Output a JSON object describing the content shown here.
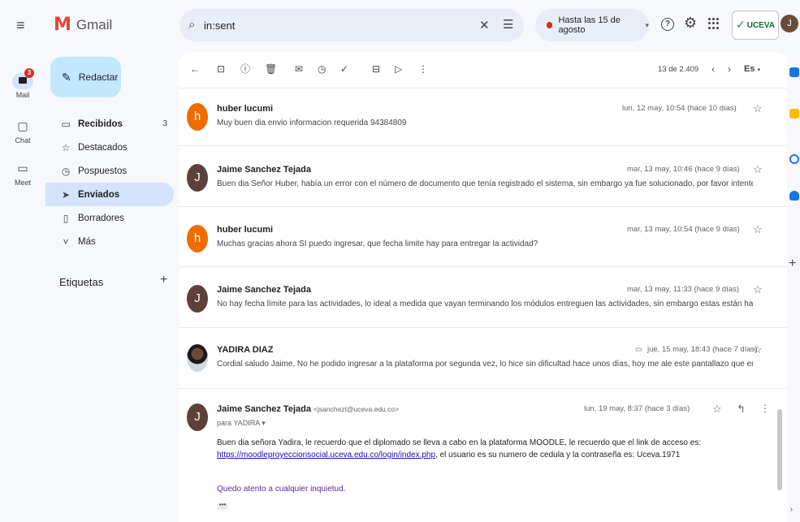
{
  "app": {
    "name": "Gmail"
  },
  "search": {
    "query": "in:sent"
  },
  "status": {
    "label": "Hasta las 15 de agosto"
  },
  "account": {
    "brand": "UCEVA",
    "avatar_letter": "J"
  },
  "rail": {
    "items": [
      {
        "label": "Mail",
        "badge": "3"
      },
      {
        "label": "Chat"
      },
      {
        "label": "Meet"
      }
    ]
  },
  "compose": {
    "label": "Redactar"
  },
  "nav": {
    "items": [
      {
        "label": "Recibidos",
        "count": "3"
      },
      {
        "label": "Destacados"
      },
      {
        "label": "Pospuestos"
      },
      {
        "label": "Enviados"
      },
      {
        "label": "Borradores"
      },
      {
        "label": "Más"
      }
    ]
  },
  "labels": {
    "title": "Etiquetas"
  },
  "toolbar": {
    "pager": "13 de 2.409",
    "lang": "Es"
  },
  "thread": [
    {
      "avatar_letter": "h",
      "sender": "huber lucumi",
      "date": "lun, 12 may, 10:54 (hace 10 días)",
      "snippet": "Muy buen dia envio informacion requerida 94384809"
    },
    {
      "avatar_letter": "J",
      "sender": "Jaime Sanchez Tejada",
      "date": "mar, 13 may, 10:46 (hace 9 días)",
      "snippet": "Buen dia Señor Huber, había un error con el número de documento que tenía registrado el sistema, sin embargo ya fue solucionado, por favor intente ingresar nuev"
    },
    {
      "avatar_letter": "h",
      "sender": "huber lucumi",
      "date": "mar, 13 may, 10:54 (hace 9 días)",
      "snippet": "Muchas gracias ahora SI puedo ingresar, que fecha limite hay para entregar la actividad?"
    },
    {
      "avatar_letter": "J",
      "sender": "Jaime Sanchez Tejada",
      "date": "mar, 13 may, 11:33 (hace 9 días)",
      "snippet": "No hay fecha límite para las actividades, lo ideal a medida que vayan terminando los módulos entreguen las actividades, sin embargo estas están habilitadas en t"
    },
    {
      "avatar_letter": "",
      "sender": "YADIRA DIAZ",
      "date": "jue, 15 may, 18:43 (hace 7 días)",
      "snippet": "Cordial saludo Jaime, No he podido ingresar a la plataforma por segunda vez, lo hice sin dificultad hace unos días, hoy me ale este pantallazo que envio. Si me"
    }
  ],
  "open_message": {
    "avatar_letter": "J",
    "sender": "Jaime Sanchez Tejada",
    "email": "<jsanchezt@uceva.edu.co>",
    "date": "lun, 19 may, 8:37 (hace 3 días)",
    "to": "para YADIRA",
    "body_before_link": "Buen dia señora Yadira, le recuerdo que el diplomado se lleva a cabo en la plataforma MOODLE, le recuerdo que el link de acceso es: ",
    "link": "https://moodleproyeccionsocial.uceva.edu.co/login/index.php",
    "body_after_link": ", el usuario es su numero de cedula y la contraseña es: Uceva.1971",
    "closing": "Quedo atento a cualquier inquietud.",
    "ellipsis": "•••"
  },
  "side_panel": {
    "colors": [
      "#1a73e8",
      "#fbbc04",
      "#1a73e8",
      "#1a73e8"
    ]
  }
}
